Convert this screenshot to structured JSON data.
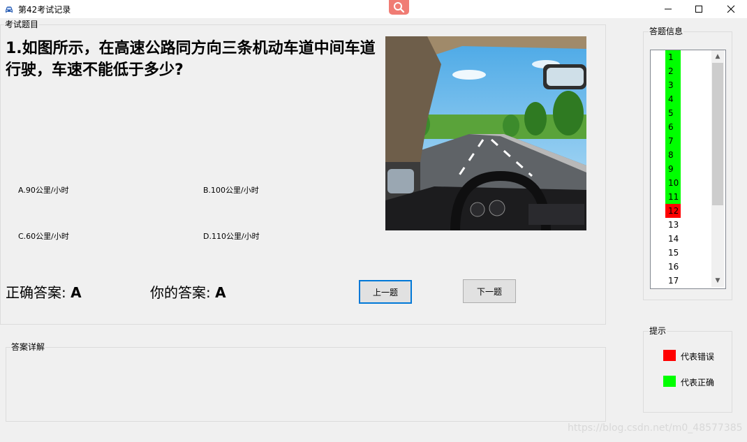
{
  "window": {
    "title": "第42考试记录"
  },
  "exam_group": {
    "label": "考试题目"
  },
  "question": {
    "text": "1.如图所示，在高速公路同方向三条机动车道中间车道行驶，车速不能低于多少?"
  },
  "options": [
    {
      "label": "A.90公里/小时"
    },
    {
      "label": "B.100公里/小时"
    },
    {
      "label": "C.60公里/小时"
    },
    {
      "label": "D.110公里/小时"
    }
  ],
  "answer": {
    "correct_label": "正确答案:",
    "correct_value": "A",
    "yours_label": "你的答案:",
    "yours_value": "A"
  },
  "buttons": {
    "prev": "上一题",
    "next": "下一题"
  },
  "explanation_group": {
    "label": "答案详解"
  },
  "answer_info": {
    "label": "答题信息",
    "items": [
      {
        "n": "1",
        "status": "correct"
      },
      {
        "n": "2",
        "status": "correct"
      },
      {
        "n": "3",
        "status": "correct"
      },
      {
        "n": "4",
        "status": "correct"
      },
      {
        "n": "5",
        "status": "correct"
      },
      {
        "n": "6",
        "status": "correct"
      },
      {
        "n": "7",
        "status": "correct"
      },
      {
        "n": "8",
        "status": "correct"
      },
      {
        "n": "9",
        "status": "correct"
      },
      {
        "n": "10",
        "status": "correct"
      },
      {
        "n": "11",
        "status": "correct"
      },
      {
        "n": "12",
        "status": "wrong"
      },
      {
        "n": "13",
        "status": "none"
      },
      {
        "n": "14",
        "status": "none"
      },
      {
        "n": "15",
        "status": "none"
      },
      {
        "n": "16",
        "status": "none"
      },
      {
        "n": "17",
        "status": "none"
      }
    ]
  },
  "hint": {
    "label": "提示",
    "wrong_text": "代表错误",
    "right_text": "代表正确"
  },
  "colors": {
    "correct": "#00ff00",
    "wrong": "#ff0000",
    "focus": "#0078d7"
  },
  "watermark": "https://blog.csdn.net/m0_48577385"
}
